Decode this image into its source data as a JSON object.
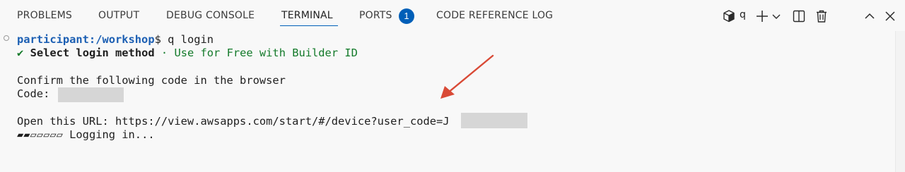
{
  "tabs": [
    {
      "label": "PROBLEMS"
    },
    {
      "label": "OUTPUT"
    },
    {
      "label": "DEBUG CONSOLE"
    },
    {
      "label": "TERMINAL",
      "active": true
    },
    {
      "label": "PORTS",
      "badge": "1"
    },
    {
      "label": "CODE REFERENCE LOG"
    }
  ],
  "toolbar": {
    "terminal_icon": "cube-icon",
    "terminal_name": "q",
    "new_terminal_icon": "plus-icon",
    "dropdown_icon": "chevron-down-icon",
    "split_icon": "split-icon",
    "kill_icon": "trash-icon",
    "maximize_icon": "chevron-up-icon",
    "close_icon": "close-icon"
  },
  "terminal": {
    "prompt_host": "participant:/workshop",
    "prompt_symbol": "$",
    "command": " q login",
    "check_mark": "✔",
    "select_label": "Select login method",
    "separator": " · ",
    "selected_option": "Use for Free with Builder ID",
    "confirm_text": "Confirm the following code in the browser",
    "code_label": "Code: ",
    "url_label": "Open this URL: ",
    "url": "https://view.awsapps.com/start/#/device?user_code=J",
    "spinner": "▰▰▱▱▱▱▱",
    "status": " Logging in..."
  },
  "colors": {
    "accent": "#005fb8",
    "prompt_host": "#1c5fb3",
    "success": "#137a2a",
    "annotation_arrow": "#d94a36",
    "redaction": "#d6d6d6"
  }
}
